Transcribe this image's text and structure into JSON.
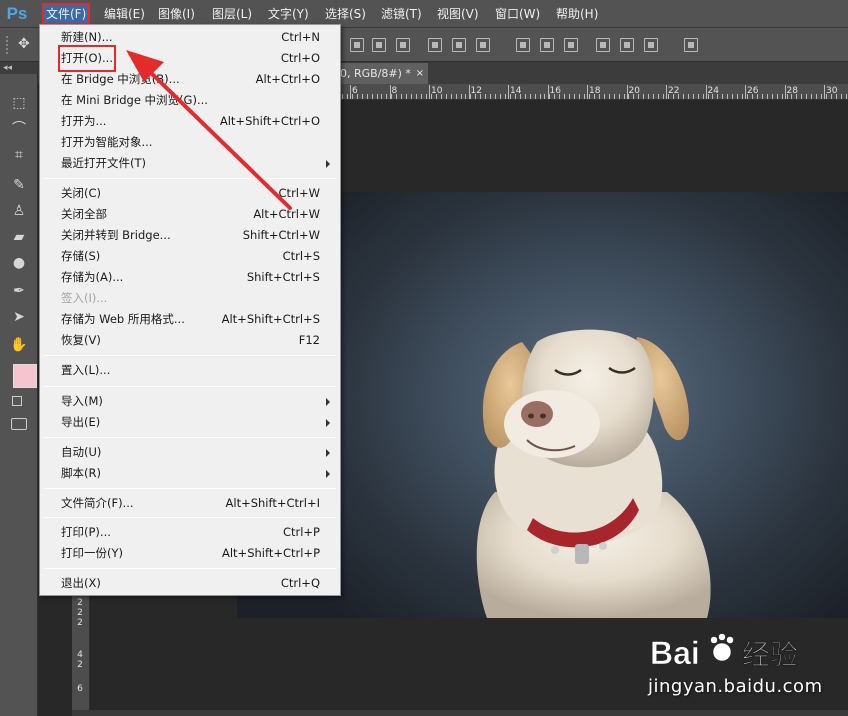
{
  "app": {
    "logo": "Ps"
  },
  "menubar": {
    "items": [
      {
        "label": "文件(F)"
      },
      {
        "label": "编辑(E)"
      },
      {
        "label": "图像(I)"
      },
      {
        "label": "图层(L)"
      },
      {
        "label": "文字(Y)"
      },
      {
        "label": "选择(S)"
      },
      {
        "label": "滤镜(T)"
      },
      {
        "label": "视图(V)"
      },
      {
        "label": "窗口(W)"
      },
      {
        "label": "帮助(H)"
      }
    ]
  },
  "toolbar": {
    "collapse": "◂◂"
  },
  "document": {
    "tab_label": "0, RGB/8#) *",
    "tab_close": "×"
  },
  "ruler": {
    "top_labels": [
      "6",
      "8",
      "10",
      "12",
      "14",
      "16",
      "18",
      "20",
      "22",
      "24",
      "26",
      "28",
      "30"
    ],
    "left_labels": [
      "2",
      "2",
      "2",
      "4",
      "2",
      "6"
    ]
  },
  "file_menu": {
    "items": [
      {
        "label": "新建(N)...",
        "shortcut": "Ctrl+N"
      },
      {
        "label": "打开(O)...",
        "shortcut": "Ctrl+O",
        "highlighted": true
      },
      {
        "label": "在 Bridge 中浏览(B)...",
        "shortcut": "Alt+Ctrl+O"
      },
      {
        "label": "在 Mini Bridge 中浏览(G)...",
        "shortcut": ""
      },
      {
        "label": "打开为...",
        "shortcut": "Alt+Shift+Ctrl+O"
      },
      {
        "label": "打开为智能对象...",
        "shortcut": ""
      },
      {
        "label": "最近打开文件(T)",
        "shortcut": "",
        "submenu": true
      },
      {
        "label": "关闭(C)",
        "shortcut": "Ctrl+W"
      },
      {
        "label": "关闭全部",
        "shortcut": "Alt+Ctrl+W"
      },
      {
        "label": "关闭并转到 Bridge...",
        "shortcut": "Shift+Ctrl+W"
      },
      {
        "label": "存储(S)",
        "shortcut": "Ctrl+S"
      },
      {
        "label": "存储为(A)...",
        "shortcut": "Shift+Ctrl+S"
      },
      {
        "label": "签入(I)...",
        "shortcut": "",
        "disabled": true
      },
      {
        "label": "存储为 Web 所用格式...",
        "shortcut": "Alt+Shift+Ctrl+S"
      },
      {
        "label": "恢复(V)",
        "shortcut": "F12"
      },
      {
        "label": "置入(L)...",
        "shortcut": ""
      },
      {
        "label": "导入(M)",
        "shortcut": "",
        "submenu": true
      },
      {
        "label": "导出(E)",
        "shortcut": "",
        "submenu": true
      },
      {
        "label": "自动(U)",
        "shortcut": "",
        "submenu": true
      },
      {
        "label": "脚本(R)",
        "shortcut": "",
        "submenu": true
      },
      {
        "label": "文件简介(F)...",
        "shortcut": "Alt+Shift+Ctrl+I"
      },
      {
        "label": "打印(P)...",
        "shortcut": "Ctrl+P"
      },
      {
        "label": "打印一份(Y)",
        "shortcut": "Alt+Shift+Ctrl+P"
      },
      {
        "label": "退出(X)",
        "shortcut": "Ctrl+Q"
      }
    ]
  },
  "watermark": {
    "brand": "Bai",
    "brand_cn": "经验",
    "url": "jingyan.baidu.com"
  },
  "colors": {
    "accent_red": "#e42a2a",
    "ps_blue": "#4ea6ea",
    "foreground_swatch": "#f5c4ce"
  }
}
